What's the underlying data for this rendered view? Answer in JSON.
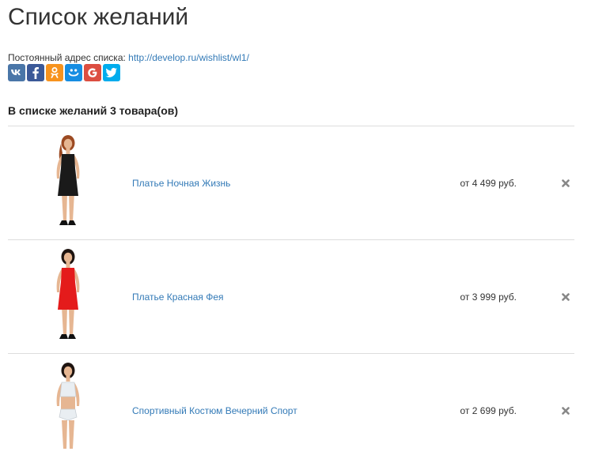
{
  "title": "Список желаний",
  "permalink": {
    "label": "Постоянный адрес списка:",
    "url": "http://develop.ru/wishlist/wl1/"
  },
  "share": [
    {
      "id": "vk",
      "name": "vk-icon",
      "glyph": "vk",
      "color": "#4a76a8"
    },
    {
      "id": "fb",
      "name": "facebook-icon",
      "glyph": "f",
      "color": "#3b5998"
    },
    {
      "id": "ok",
      "name": "odnoklassniki-icon",
      "glyph": "ok",
      "color": "#f7931e"
    },
    {
      "id": "mm",
      "name": "moimir-icon",
      "glyph": "mm",
      "color": "#168de2"
    },
    {
      "id": "gp",
      "name": "google-plus-icon",
      "glyph": "G",
      "color": "#dc4e41"
    },
    {
      "id": "tw",
      "name": "twitter-icon",
      "glyph": "tw",
      "color": "#00aced"
    }
  ],
  "count_heading": "В списке желаний 3 товара(ов)",
  "items": [
    {
      "name": "Платье Ночная Жизнь",
      "price": "от 4 499 руб.",
      "dress_color": "#1a1a1a",
      "hair_color": "#9c4a22"
    },
    {
      "name": "Платье Красная Фея",
      "price": "от 3 999 руб.",
      "dress_color": "#e41b1b",
      "hair_color": "#1e1410"
    },
    {
      "name": "Спортивный Костюм Вечерний Спорт",
      "price": "от 2 699 руб.",
      "dress_color": "#e9eef2",
      "hair_color": "#1e1410"
    }
  ],
  "colors": {
    "link": "#337ab7",
    "divider": "#dddddd",
    "remove_icon": "#888888"
  }
}
